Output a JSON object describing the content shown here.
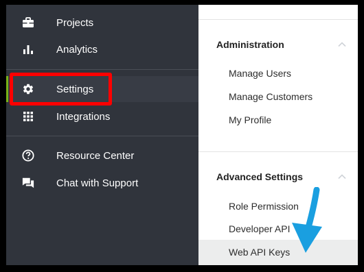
{
  "sidebar": {
    "items": [
      {
        "label": "Projects",
        "icon": "briefcase-icon"
      },
      {
        "label": "Analytics",
        "icon": "bar-chart-icon"
      },
      {
        "label": "Settings",
        "icon": "gear-icon"
      },
      {
        "label": "Integrations",
        "icon": "grid-icon"
      },
      {
        "label": "Resource Center",
        "icon": "help-circle-icon"
      },
      {
        "label": "Chat with Support",
        "icon": "chat-icon"
      }
    ],
    "active_item": "Settings"
  },
  "panel": {
    "administration": {
      "title": "Administration",
      "links": [
        "Manage Users",
        "Manage Customers",
        "My Profile"
      ]
    },
    "advanced": {
      "title": "Advanced Settings",
      "links": [
        "Role Permission",
        "Developer API",
        "Web API Keys"
      ]
    }
  },
  "annotations": {
    "highlight_color": "#ff0000",
    "arrow_color": "#1a9fe0",
    "active_accent": "#7ab317"
  }
}
